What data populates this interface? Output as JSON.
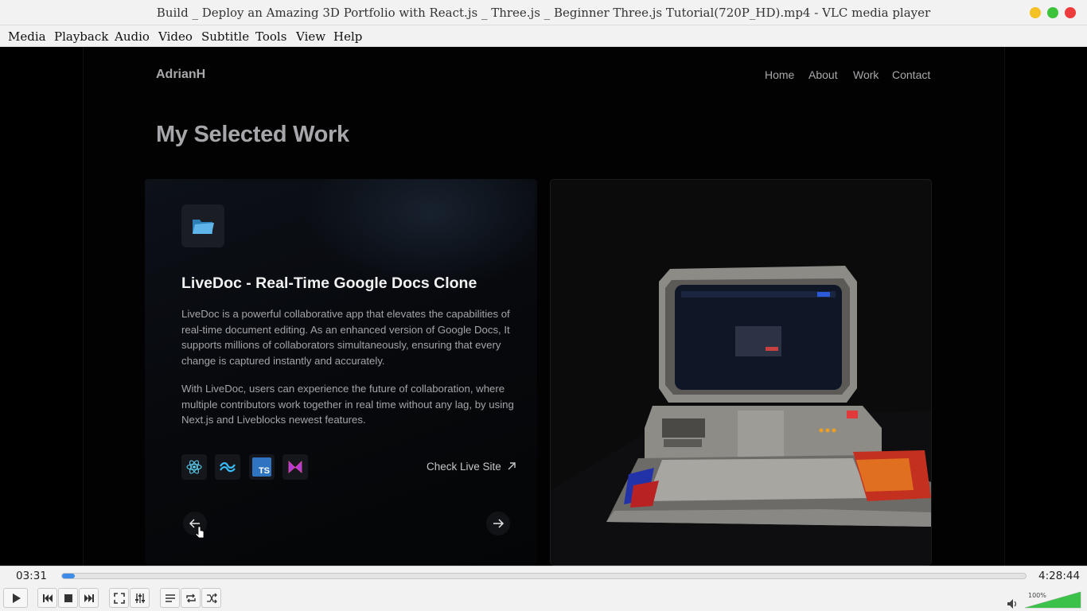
{
  "window": {
    "title": "Build _ Deploy an Amazing 3D Portfolio with React.js _ Three.js _ Beginner Three.js Tutorial(720P_HD).mp4 - VLC media player"
  },
  "menu": [
    "Media",
    "Playback",
    "Audio",
    "Video",
    "Subtitle",
    "Tools",
    "View",
    "Help"
  ],
  "video": {
    "brand": "AdrianH",
    "nav": [
      "Home",
      "About",
      "Work",
      "Contact"
    ],
    "heading": "My Selected Work",
    "project": {
      "title": "LiveDoc - Real-Time Google Docs Clone",
      "desc1": "LiveDoc is a powerful collaborative app that elevates the capabilities of real-time document editing. As an enhanced version of Google Docs, It supports millions of collaborators simultaneously, ensuring that every change is captured instantly and accurately.",
      "desc2": "With LiveDoc, users can experience the future of collaboration, where multiple contributors work together in real time without any lag, by using Next.js and Liveblocks newest features.",
      "live_link": "Check Live Site",
      "tech_icons": [
        "react-icon",
        "tailwind-icon",
        "typescript-icon",
        "liveblocks-icon"
      ],
      "ts_label": "TS"
    }
  },
  "player": {
    "elapsed": "03:31",
    "duration": "4:28:44",
    "progress_fraction": 0.013,
    "volume": "100%",
    "accent": "#3d8be8"
  }
}
